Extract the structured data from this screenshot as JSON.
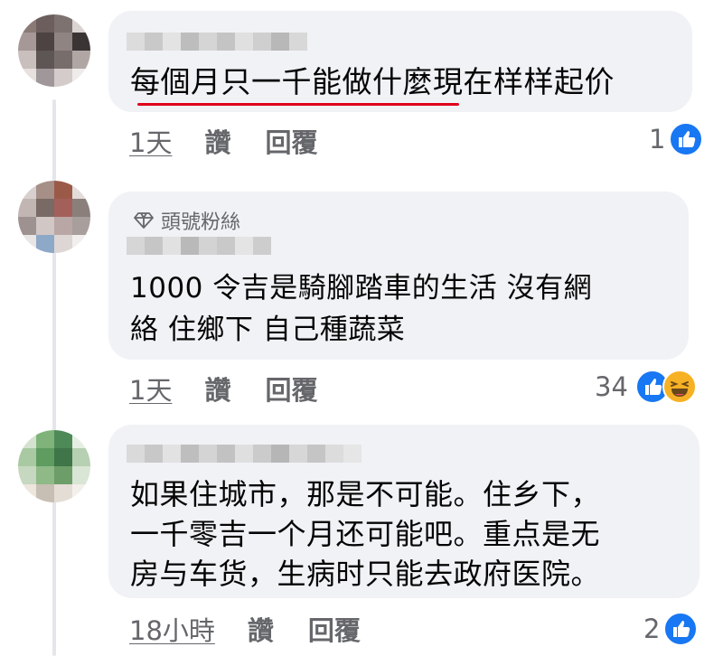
{
  "comments": [
    {
      "author_badge": "",
      "text_lines": [
        "每個月只一千能做什麼現在样样起价"
      ],
      "time": "1天",
      "like_label": "讚",
      "reply_label": "回覆",
      "reaction_count": "1",
      "reactions": [
        "like-icon"
      ]
    },
    {
      "author_badge": "頭號粉絲",
      "text_lines": [
        "1000 令吉是騎腳踏車的生活 沒有網",
        "絡 住鄉下 自己種蔬菜"
      ],
      "time": "1天",
      "like_label": "讚",
      "reply_label": "回覆",
      "reaction_count": "34",
      "reactions": [
        "like-icon",
        "haha-icon"
      ]
    },
    {
      "author_badge": "",
      "text_lines": [
        "如果住城市，那是不可能。住乡下，",
        "一千零吉一个月还可能吧。重点是无",
        "房与车货，生病时只能去政府医院。"
      ],
      "time": "18小時",
      "like_label": "讚",
      "reply_label": "回覆",
      "reaction_count": "2",
      "reactions": [
        "like-icon"
      ]
    }
  ],
  "colors": {
    "bubble": "#f0f2f5",
    "meta_text": "#65676b",
    "like_blue": "#1877f2",
    "haha_yellow": "#f7b125",
    "highlight_underline": "#e0001a"
  }
}
